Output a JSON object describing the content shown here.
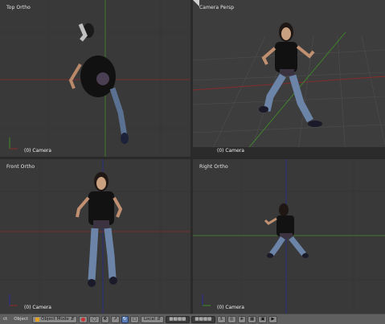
{
  "viewports": {
    "top": {
      "title": "Top Ortho",
      "object_label": "(0) Camera"
    },
    "persp": {
      "title": "Camera Persp",
      "object_label": "(0) Camera"
    },
    "front": {
      "title": "Front Ortho",
      "object_label": "(0) Camera"
    },
    "right": {
      "title": "Right Ortho",
      "object_label": "(0) Camera"
    }
  },
  "toolbar": {
    "menu_select": "ct",
    "menu_object": "Object",
    "mode": "Object Mode",
    "pivot": "Local",
    "mode_icon": "cube-icon",
    "view_icon": "sphere-icon"
  },
  "colors": {
    "viewport_bg": "#393939",
    "x_axis": "#8a2a2a",
    "y_axis": "#3f8a2a",
    "z_axis": "#2a2a9a",
    "toolbar_bg": "#5f5f5f",
    "active_button": "#5a7fb8"
  }
}
